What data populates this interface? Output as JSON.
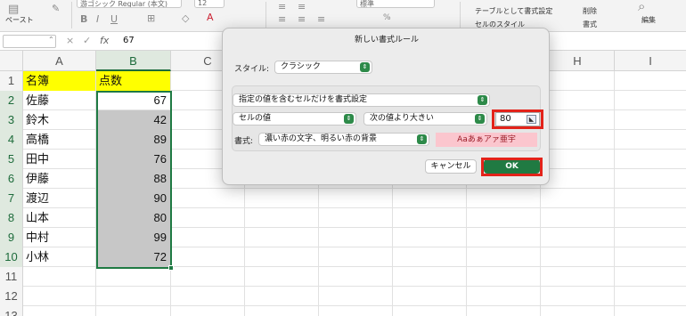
{
  "ribbon": {
    "paste_label": "ペースト",
    "font_name": "游ゴシック Regular (本文)",
    "font_size": "12",
    "number_format": "標準",
    "format_as_table": "テーブルとして書式設定",
    "cell_styles": "セルのスタイル",
    "delete_label": "削除",
    "format_label": "書式",
    "edit_label": "編集",
    "icons": [
      "paste-icon",
      "bold-icon",
      "italic-icon",
      "underline-icon",
      "border-icon",
      "fill-color-icon",
      "font-color-icon",
      "align-icon",
      "search-icon"
    ]
  },
  "formula_bar": {
    "name_box": "",
    "cancel_icon": "×",
    "enter_icon": "✓",
    "fx_icon": "fx",
    "value": "67"
  },
  "sheet": {
    "columns": [
      "A",
      "B",
      "C",
      "D",
      "E",
      "F",
      "G",
      "H",
      "I"
    ],
    "rows": [
      {
        "num": "1",
        "a": "名簿",
        "b": "点数"
      },
      {
        "num": "2",
        "a": "佐藤",
        "b": "67"
      },
      {
        "num": "3",
        "a": "鈴木",
        "b": "42"
      },
      {
        "num": "4",
        "a": "高橋",
        "b": "89"
      },
      {
        "num": "5",
        "a": "田中",
        "b": "76"
      },
      {
        "num": "6",
        "a": "伊藤",
        "b": "88"
      },
      {
        "num": "7",
        "a": "渡辺",
        "b": "90"
      },
      {
        "num": "8",
        "a": "山本",
        "b": "80"
      },
      {
        "num": "9",
        "a": "中村",
        "b": "99"
      },
      {
        "num": "10",
        "a": "小林",
        "b": "72"
      },
      {
        "num": "11",
        "a": "",
        "b": ""
      },
      {
        "num": "12",
        "a": "",
        "b": ""
      },
      {
        "num": "13",
        "a": "",
        "b": ""
      }
    ],
    "header_fill": "#ffff00",
    "selection_fill": "#c7c7c7",
    "selection_border": "#1f7a43"
  },
  "dialog": {
    "title": "新しい書式ルール",
    "style_label": "スタイル:",
    "style_value": "クラシック",
    "rule_type": "指定の値を含むセルだけを書式設定",
    "cell_value": "セルの値",
    "operator": "次の値より大きい",
    "threshold": "80",
    "format_label": "書式:",
    "format_value": "濃い赤の文字、明るい赤の背景",
    "preview_text": "Aaあぁアァ亜宇",
    "cancel": "キャンセル",
    "ok": "OK",
    "highlight_color": "#e3231a",
    "ok_color": "#207a42"
  }
}
